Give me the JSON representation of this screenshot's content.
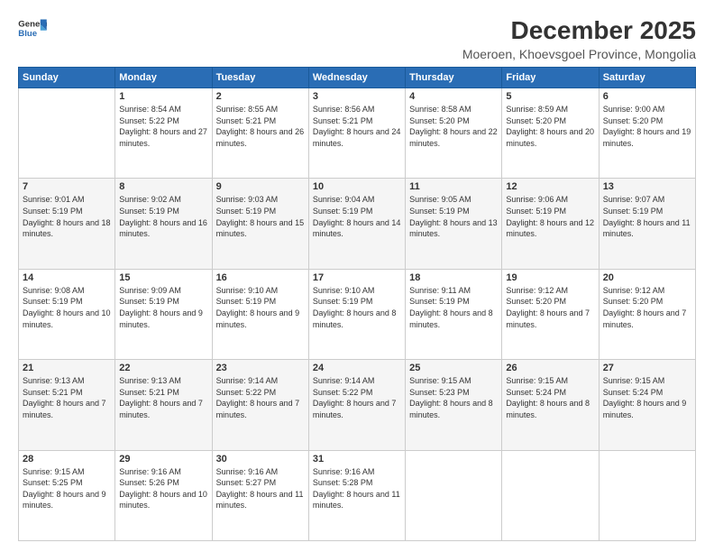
{
  "header": {
    "logo_line1": "General",
    "logo_line2": "Blue",
    "title": "December 2025",
    "subtitle": "Moeroen, Khoevsgoel Province, Mongolia"
  },
  "days_of_week": [
    "Sunday",
    "Monday",
    "Tuesday",
    "Wednesday",
    "Thursday",
    "Friday",
    "Saturday"
  ],
  "weeks": [
    [
      {
        "day": "",
        "empty": true
      },
      {
        "day": "1",
        "sunrise": "8:54 AM",
        "sunset": "5:22 PM",
        "daylight": "8 hours and 27 minutes."
      },
      {
        "day": "2",
        "sunrise": "8:55 AM",
        "sunset": "5:21 PM",
        "daylight": "8 hours and 26 minutes."
      },
      {
        "day": "3",
        "sunrise": "8:56 AM",
        "sunset": "5:21 PM",
        "daylight": "8 hours and 24 minutes."
      },
      {
        "day": "4",
        "sunrise": "8:58 AM",
        "sunset": "5:20 PM",
        "daylight": "8 hours and 22 minutes."
      },
      {
        "day": "5",
        "sunrise": "8:59 AM",
        "sunset": "5:20 PM",
        "daylight": "8 hours and 20 minutes."
      },
      {
        "day": "6",
        "sunrise": "9:00 AM",
        "sunset": "5:20 PM",
        "daylight": "8 hours and 19 minutes."
      }
    ],
    [
      {
        "day": "7",
        "sunrise": "9:01 AM",
        "sunset": "5:19 PM",
        "daylight": "8 hours and 18 minutes."
      },
      {
        "day": "8",
        "sunrise": "9:02 AM",
        "sunset": "5:19 PM",
        "daylight": "8 hours and 16 minutes."
      },
      {
        "day": "9",
        "sunrise": "9:03 AM",
        "sunset": "5:19 PM",
        "daylight": "8 hours and 15 minutes."
      },
      {
        "day": "10",
        "sunrise": "9:04 AM",
        "sunset": "5:19 PM",
        "daylight": "8 hours and 14 minutes."
      },
      {
        "day": "11",
        "sunrise": "9:05 AM",
        "sunset": "5:19 PM",
        "daylight": "8 hours and 13 minutes."
      },
      {
        "day": "12",
        "sunrise": "9:06 AM",
        "sunset": "5:19 PM",
        "daylight": "8 hours and 12 minutes."
      },
      {
        "day": "13",
        "sunrise": "9:07 AM",
        "sunset": "5:19 PM",
        "daylight": "8 hours and 11 minutes."
      }
    ],
    [
      {
        "day": "14",
        "sunrise": "9:08 AM",
        "sunset": "5:19 PM",
        "daylight": "8 hours and 10 minutes."
      },
      {
        "day": "15",
        "sunrise": "9:09 AM",
        "sunset": "5:19 PM",
        "daylight": "8 hours and 9 minutes."
      },
      {
        "day": "16",
        "sunrise": "9:10 AM",
        "sunset": "5:19 PM",
        "daylight": "8 hours and 9 minutes."
      },
      {
        "day": "17",
        "sunrise": "9:10 AM",
        "sunset": "5:19 PM",
        "daylight": "8 hours and 8 minutes."
      },
      {
        "day": "18",
        "sunrise": "9:11 AM",
        "sunset": "5:19 PM",
        "daylight": "8 hours and 8 minutes."
      },
      {
        "day": "19",
        "sunrise": "9:12 AM",
        "sunset": "5:20 PM",
        "daylight": "8 hours and 7 minutes."
      },
      {
        "day": "20",
        "sunrise": "9:12 AM",
        "sunset": "5:20 PM",
        "daylight": "8 hours and 7 minutes."
      }
    ],
    [
      {
        "day": "21",
        "sunrise": "9:13 AM",
        "sunset": "5:21 PM",
        "daylight": "8 hours and 7 minutes."
      },
      {
        "day": "22",
        "sunrise": "9:13 AM",
        "sunset": "5:21 PM",
        "daylight": "8 hours and 7 minutes."
      },
      {
        "day": "23",
        "sunrise": "9:14 AM",
        "sunset": "5:22 PM",
        "daylight": "8 hours and 7 minutes."
      },
      {
        "day": "24",
        "sunrise": "9:14 AM",
        "sunset": "5:22 PM",
        "daylight": "8 hours and 7 minutes."
      },
      {
        "day": "25",
        "sunrise": "9:15 AM",
        "sunset": "5:23 PM",
        "daylight": "8 hours and 8 minutes."
      },
      {
        "day": "26",
        "sunrise": "9:15 AM",
        "sunset": "5:24 PM",
        "daylight": "8 hours and 8 minutes."
      },
      {
        "day": "27",
        "sunrise": "9:15 AM",
        "sunset": "5:24 PM",
        "daylight": "8 hours and 9 minutes."
      }
    ],
    [
      {
        "day": "28",
        "sunrise": "9:15 AM",
        "sunset": "5:25 PM",
        "daylight": "8 hours and 9 minutes."
      },
      {
        "day": "29",
        "sunrise": "9:16 AM",
        "sunset": "5:26 PM",
        "daylight": "8 hours and 10 minutes."
      },
      {
        "day": "30",
        "sunrise": "9:16 AM",
        "sunset": "5:27 PM",
        "daylight": "8 hours and 11 minutes."
      },
      {
        "day": "31",
        "sunrise": "9:16 AM",
        "sunset": "5:28 PM",
        "daylight": "8 hours and 11 minutes."
      },
      {
        "day": "",
        "empty": true
      },
      {
        "day": "",
        "empty": true
      },
      {
        "day": "",
        "empty": true
      }
    ]
  ],
  "labels": {
    "sunrise_prefix": "Sunrise: ",
    "sunset_prefix": "Sunset: ",
    "daylight_prefix": "Daylight: "
  }
}
